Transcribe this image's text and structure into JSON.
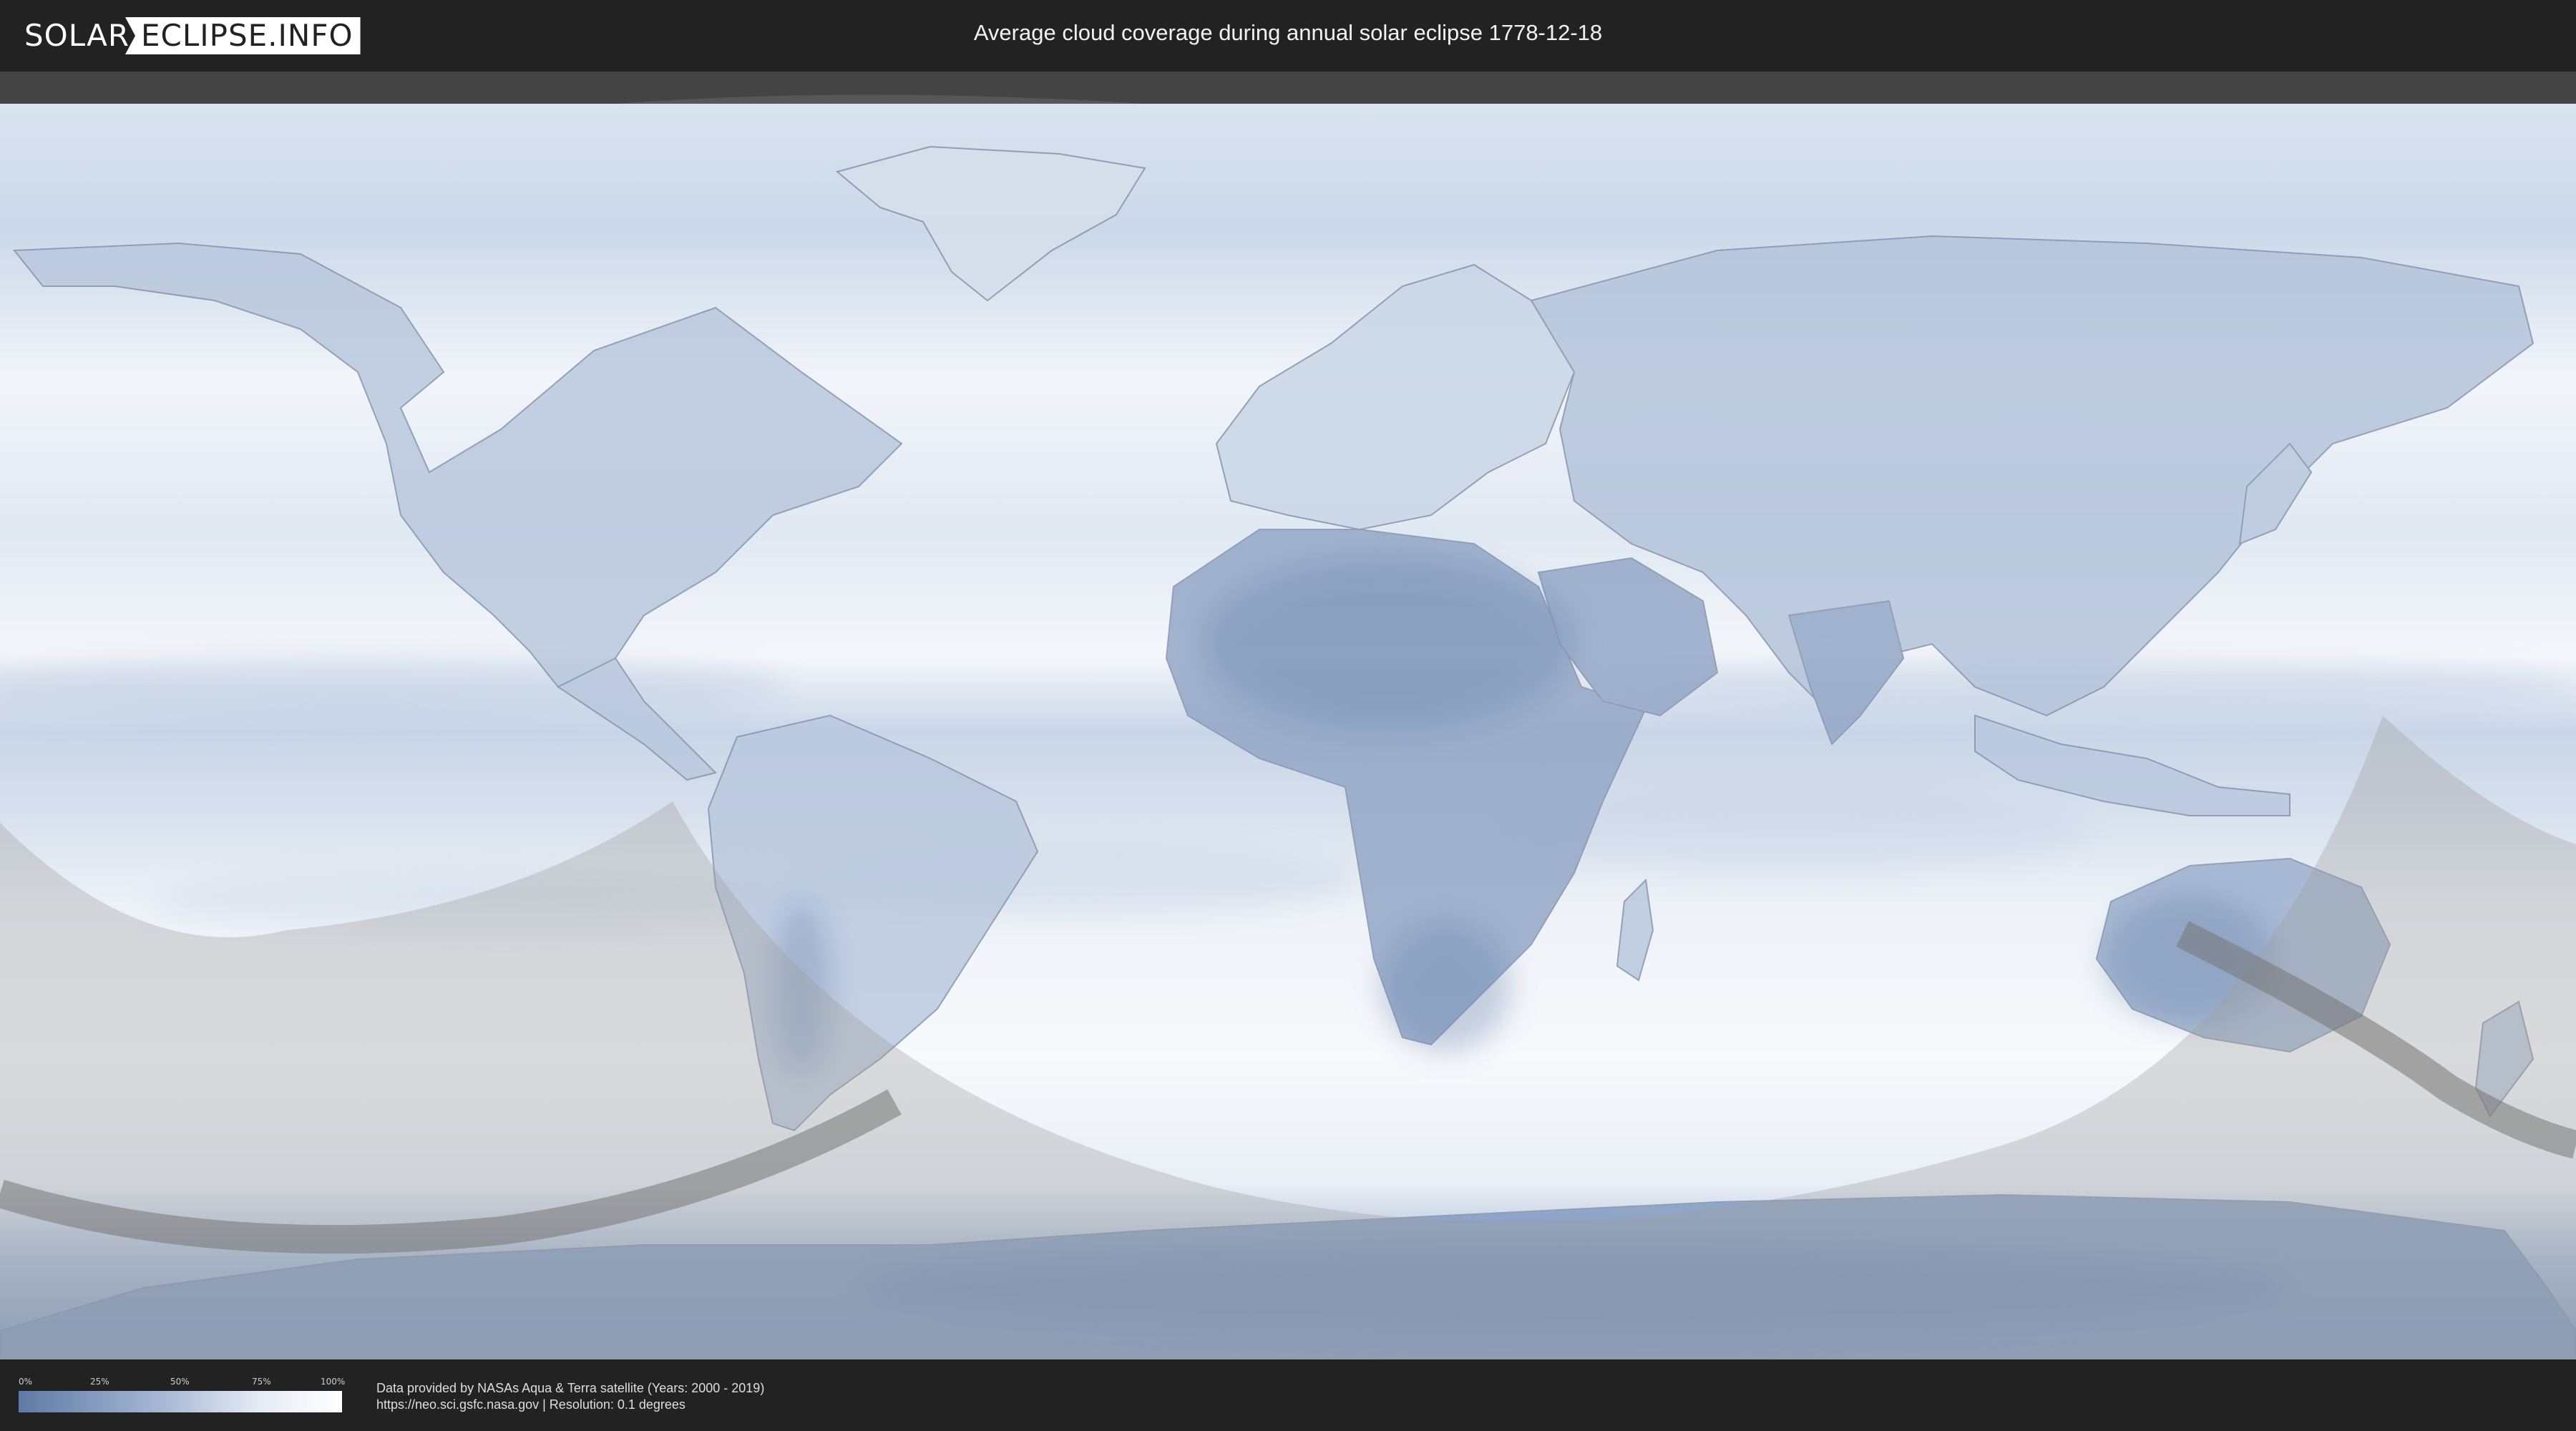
{
  "header": {
    "logo_left": "SOLAR",
    "logo_right": "ECLIPSE.INFO",
    "title": "Average cloud coverage during annual solar eclipse 1778-12-18"
  },
  "map": {
    "colors": {
      "ocean_base": "#e9eef6",
      "cloud_low": "#6e89b4",
      "cloud_mid": "#a9bbd6",
      "cloud_high": "#ffffff",
      "outside_visibility": "#9a9a9a",
      "annular_path": "#7a7a7a"
    }
  },
  "legend": {
    "ticks": [
      "0%",
      "25%",
      "50%",
      "75%",
      "100%"
    ],
    "gradient": [
      "#5f7aa6",
      "#a8b9d4",
      "#e6ecf5",
      "#ffffff"
    ]
  },
  "footer": {
    "credit_line1": "Data provided by NASAs Aqua & Terra satellite (Years: 2000 - 2019)",
    "credit_line2": "https://neo.sci.gsfc.nasa.gov | Resolution: 0.1 degrees"
  }
}
